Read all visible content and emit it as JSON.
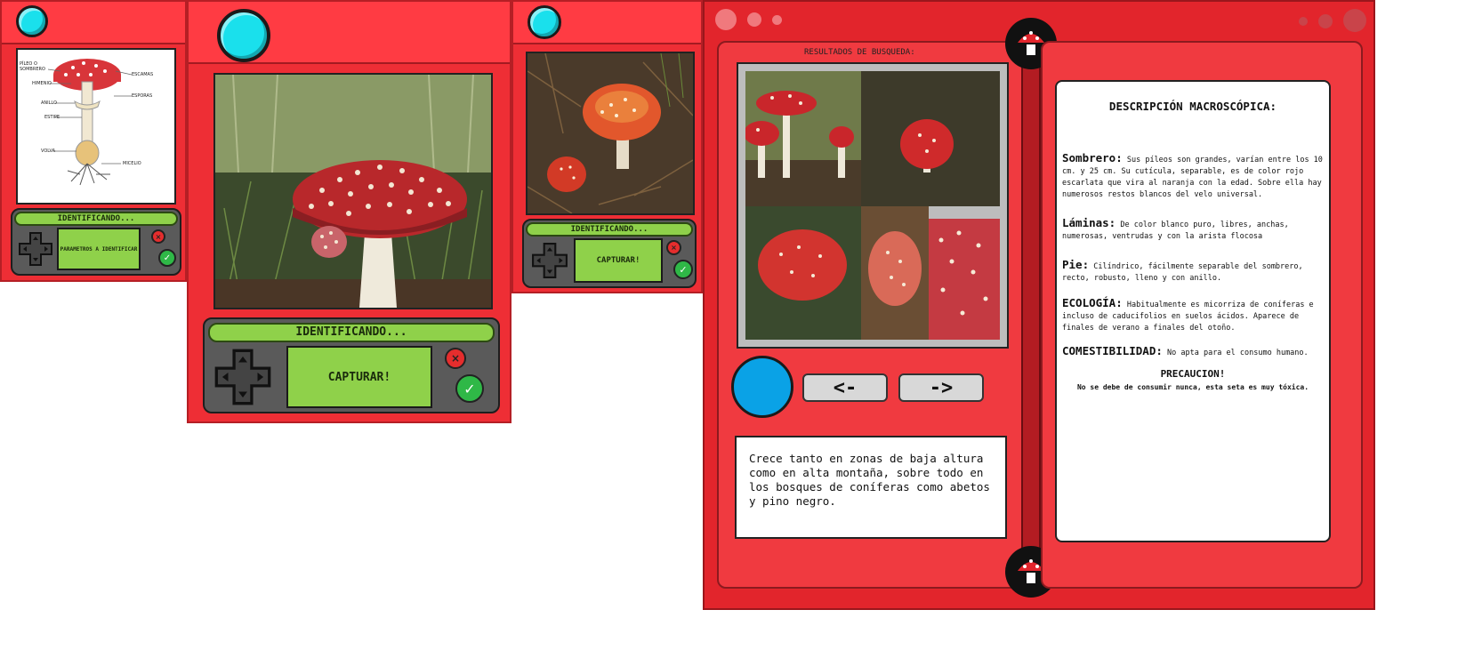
{
  "device1": {
    "strip": "IDENTIFICANDO...",
    "lcd": "PARAMETROS A IDENTIFICAR",
    "diagram_labels": [
      "PÍLEO O SOMBRERO",
      "ESCAMAS",
      "HIMENIO",
      "ESPORAS",
      "ANILLO",
      "ESTIPE",
      "VOLVA",
      "MICELIO"
    ]
  },
  "device2": {
    "strip": "IDENTIFICANDO...",
    "lcd": "CAPTURAR!"
  },
  "device3": {
    "strip": "IDENTIFICANDO...",
    "lcd": "CAPTURAR!"
  },
  "pokedex": {
    "results_title": "RESULTADOS DE BUSQUEDA:",
    "prev_label": "<-",
    "next_label": "->",
    "habitat_text": "Crece tanto en zonas de baja altura como en alta montaña, sobre todo en los bosques de coníferas como abetos y pino negro.",
    "desc_title": "DESCRIPCIÓN MACROSCÓPICA:",
    "sombrero_label": "Sombrero:",
    "sombrero_text": "Sus píleos son grandes, varían entre los 10 cm. y 25 cm. Su cutícula, separable, es de color rojo escarlata que vira al naranja con la edad. Sobre ella hay numerosos restos blancos del velo universal.",
    "laminas_label": "Láminas:",
    "laminas_text": "De color blanco puro, libres, anchas, numerosas, ventrudas y con la arista flocosa",
    "pie_label": "Pie:",
    "pie_text": "Cilíndrico, fácilmente separable del sombrero, recto, robusto, lleno y con anillo.",
    "ecologia_label": "ECOLOGÍA:",
    "ecologia_text": "Habitualmente es micorriza de coníferas e incluso de caducifolios en suelos ácidos. Aparece de finales de verano a finales del otoño.",
    "comest_label": "COMESTIBILIDAD:",
    "comest_text": "No apta para el consumo humano.",
    "precaucion_title": "PRECAUCION!",
    "precaucion_text": "No se debe de consumir nunca, esta seta es muy tóxica."
  },
  "colors": {
    "body_red": "#ee2e35",
    "lens_cyan": "#1ae0ec",
    "lcd_green": "#8fd14a",
    "blue_button": "#0aa2e6"
  }
}
